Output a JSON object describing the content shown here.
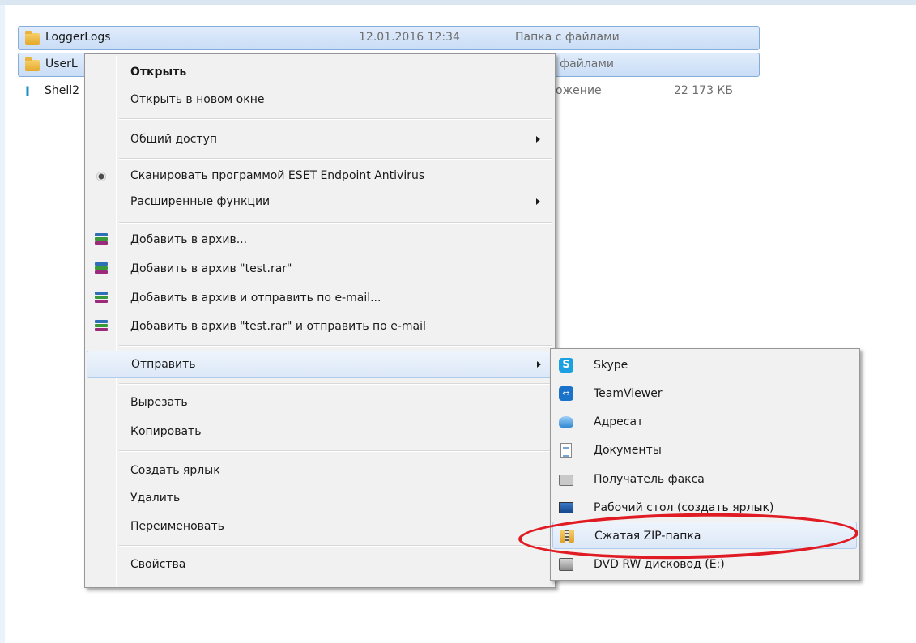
{
  "files": [
    {
      "name": "LoggerLogs",
      "date": "12.01.2016 12:34",
      "type": "Папка с файлами",
      "size": "",
      "icon": "folder-icon",
      "selected": true
    },
    {
      "name": "UserL",
      "date": "",
      "type": "с файлами",
      "size": "",
      "icon": "folder-icon",
      "selected": true
    },
    {
      "name": "Shell2",
      "date": "",
      "type": "ожение",
      "size": "22 173 КБ",
      "icon": "application-icon",
      "selected": false
    }
  ],
  "context_menu": {
    "open": "Открыть",
    "open_new_window": "Открыть в новом окне",
    "share": "Общий доступ",
    "scan_eset": "Сканировать программой ESET Endpoint Antivirus",
    "advanced": "Расширенные функции",
    "add_archive": "Добавить в архив...",
    "add_archive_rar": "Добавить в архив \"test.rar\"",
    "add_archive_email": "Добавить в архив и отправить по e-mail...",
    "add_archive_rar_email": "Добавить в архив \"test.rar\" и отправить по e-mail",
    "send_to": "Отправить",
    "cut": "Вырезать",
    "copy": "Копировать",
    "create_shortcut": "Создать ярлык",
    "delete": "Удалить",
    "rename": "Переименовать",
    "properties": "Свойства"
  },
  "send_to_menu": {
    "skype": "Skype",
    "teamviewer": "TeamViewer",
    "mail_recipient": "Адресат",
    "documents": "Документы",
    "fax_recipient": "Получатель факса",
    "desktop": "Рабочий стол (создать ярлык)",
    "zip_folder": "Сжатая ZIP-папка",
    "dvd_drive": "DVD RW дисковод (E:)"
  },
  "colors": {
    "highlight_ellipse": "#e01b24",
    "selection": "#c9ddf6"
  }
}
